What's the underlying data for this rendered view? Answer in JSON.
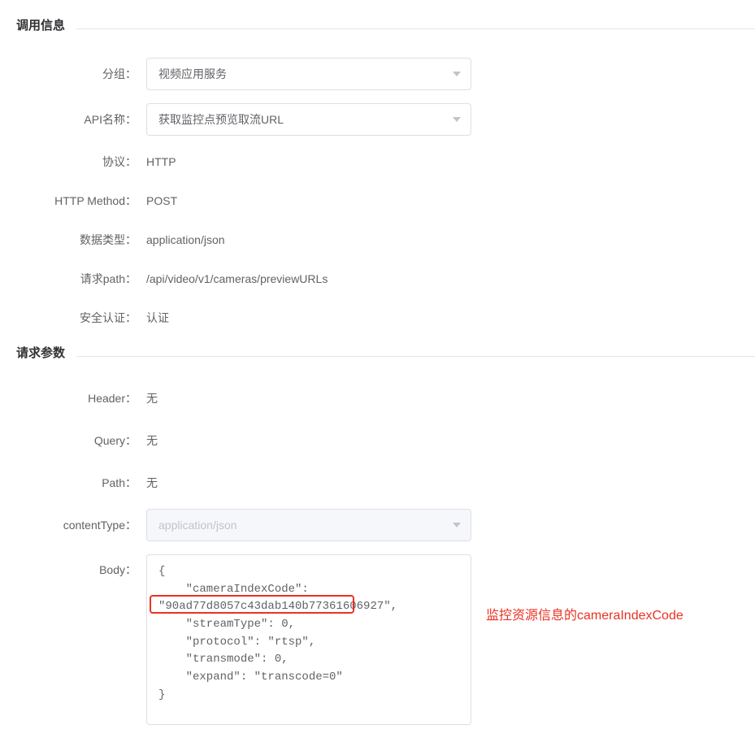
{
  "sections": {
    "call_info": {
      "title": "调用信息",
      "rows": {
        "group": {
          "label": "分组：",
          "value": "视频应用服务"
        },
        "api_name": {
          "label": "API名称：",
          "value": "获取监控点预览取流URL"
        },
        "protocol": {
          "label": "协议：",
          "value": "HTTP"
        },
        "http_method": {
          "label": "HTTP Method：",
          "value": "POST"
        },
        "data_type": {
          "label": "数据类型：",
          "value": "application/json"
        },
        "request_path": {
          "label": "请求path：",
          "value": "/api/video/v1/cameras/previewURLs"
        },
        "auth": {
          "label": "安全认证：",
          "value": "认证"
        }
      }
    },
    "request_params": {
      "title": "请求参数",
      "rows": {
        "header": {
          "label": "Header：",
          "value": "无"
        },
        "query": {
          "label": "Query：",
          "value": "无"
        },
        "path": {
          "label": "Path：",
          "value": "无"
        },
        "content_type": {
          "label": "contentType：",
          "value": "application/json"
        },
        "body": {
          "label": "Body：",
          "lines": [
            "{",
            "    \"cameraIndexCode\":",
            "\"90ad77d8057c43dab140b77361606927\",",
            "    \"streamType\": 0,",
            "    \"protocol\": \"rtsp\",",
            "    \"transmode\": 0,",
            "    \"expand\": \"transcode=0\"",
            "}"
          ]
        }
      }
    }
  },
  "annotation": "监控资源信息的cameraIndexCode"
}
